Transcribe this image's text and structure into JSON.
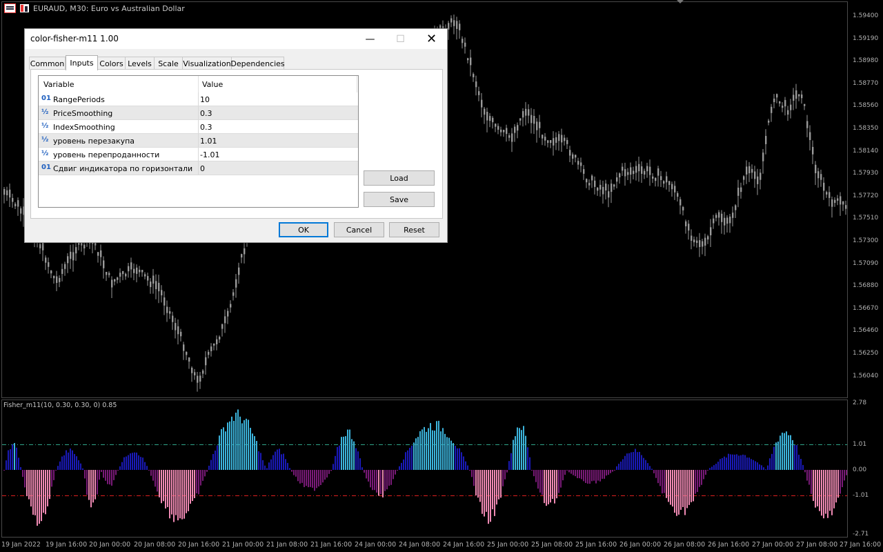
{
  "chart_header": {
    "symbol_text": "EURAUD, M30:  Euro vs Australian Dollar"
  },
  "indicator_label": "Fisher_m11(10, 0.30, 0.30, 0) 0.85",
  "price_axis": [
    "1.59400",
    "1.59190",
    "1.58980",
    "1.58770",
    "1.58560",
    "1.58350",
    "1.58140",
    "1.57930",
    "1.57720",
    "1.57510",
    "1.57300",
    "1.57090",
    "1.56880",
    "1.56670",
    "1.56460",
    "1.56250",
    "1.56040"
  ],
  "indicator_axis": [
    "2.78",
    "1.01",
    "0.00",
    "-1.01",
    "-2.71"
  ],
  "time_axis": [
    "19 Jan 2022",
    "19 Jan 16:00",
    "20 Jan 00:00",
    "20 Jan 08:00",
    "20 Jan 16:00",
    "21 Jan 00:00",
    "21 Jan 08:00",
    "21 Jan 16:00",
    "24 Jan 00:00",
    "24 Jan 08:00",
    "24 Jan 16:00",
    "25 Jan 00:00",
    "25 Jan 08:00",
    "25 Jan 16:00",
    "26 Jan 00:00",
    "26 Jan 08:00",
    "26 Jan 16:00",
    "27 Jan 00:00",
    "27 Jan 08:00",
    "27 Jan 16:00"
  ],
  "colors": {
    "background": "#000000",
    "candles": "#9a9a9a",
    "bull_strong": "#3cb4dc",
    "bull_weak": "#1a1ab8",
    "bear_strong": "#f08ab4",
    "bear_weak": "#7a1a78",
    "upper_level": "#2fa58a",
    "lower_level": "#e02020"
  },
  "dialog": {
    "title": "color-fisher-m11 1.00",
    "tabs": [
      "Common",
      "Inputs",
      "Colors",
      "Levels",
      "Scale",
      "Visualization",
      "Dependencies"
    ],
    "active_tab": "Inputs",
    "columns": [
      "Variable",
      "Value"
    ],
    "rows": [
      {
        "icon": "01",
        "name": "RangePeriods",
        "value": "10"
      },
      {
        "icon": "½",
        "name": "PriceSmoothing",
        "value": "0.3"
      },
      {
        "icon": "½",
        "name": "IndexSmoothing",
        "value": "0.3"
      },
      {
        "icon": "½",
        "name": "уровень перезакупа",
        "value": "1.01"
      },
      {
        "icon": "½",
        "name": "уровень перепроданности",
        "value": "-1.01"
      },
      {
        "icon": "01",
        "name": "Сдвиг индикатора по горизонтали в ...",
        "value": "0"
      }
    ],
    "load_label": "Load",
    "save_label": "Save",
    "ok_label": "OK",
    "cancel_label": "Cancel",
    "reset_label": "Reset"
  }
}
